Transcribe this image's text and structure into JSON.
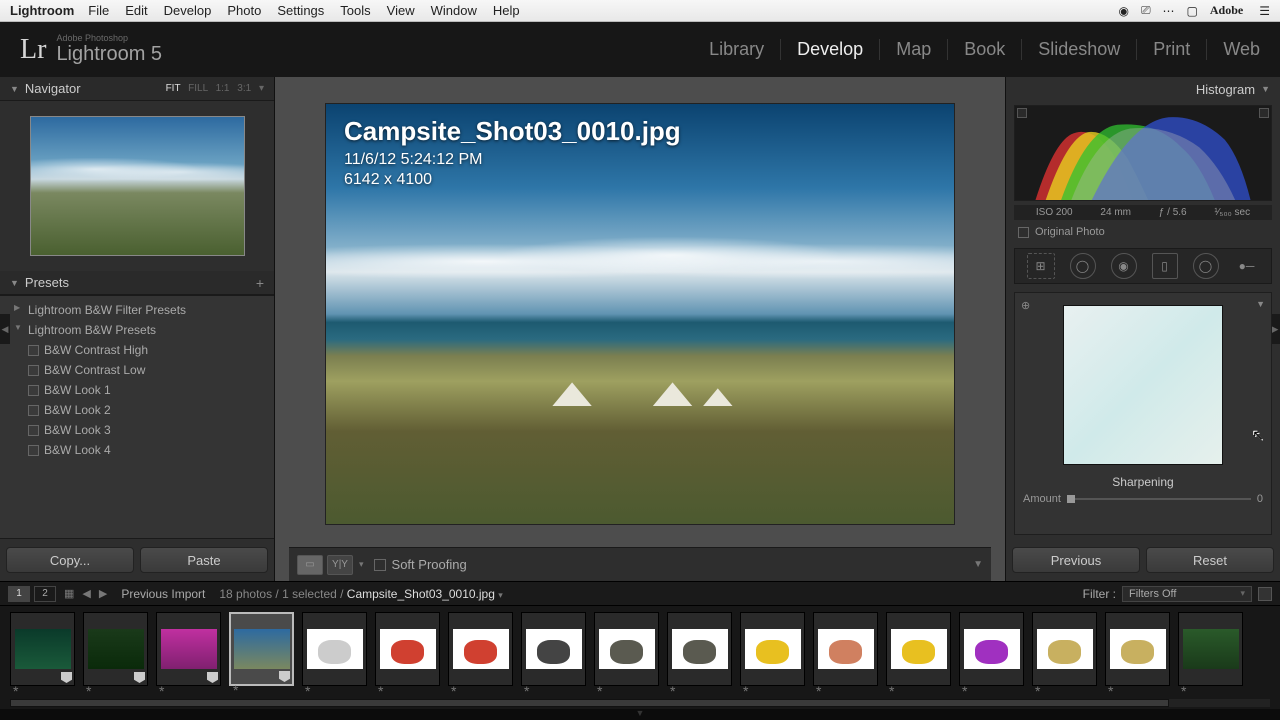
{
  "menubar": {
    "app": "Lightroom",
    "items": [
      "File",
      "Edit",
      "Develop",
      "Photo",
      "Settings",
      "Tools",
      "View",
      "Window",
      "Help"
    ],
    "right_brand": "Adobe"
  },
  "branding": {
    "logo": "Lr",
    "line1": "Adobe Photoshop",
    "line2": "Lightroom 5"
  },
  "modules": [
    "Library",
    "Develop",
    "Map",
    "Book",
    "Slideshow",
    "Print",
    "Web"
  ],
  "active_module": "Develop",
  "navigator": {
    "title": "Navigator",
    "zoom_modes": [
      "FIT",
      "FILL",
      "1:1",
      "3:1"
    ],
    "active_zoom": "FIT"
  },
  "presets": {
    "title": "Presets",
    "folders": [
      {
        "name": "Lightroom B&W Filter Presets",
        "open": false,
        "items": []
      },
      {
        "name": "Lightroom B&W Presets",
        "open": true,
        "items": [
          "B&W Contrast High",
          "B&W Contrast Low",
          "B&W Look 1",
          "B&W Look 2",
          "B&W Look 3",
          "B&W Look 4"
        ]
      }
    ]
  },
  "left_buttons": {
    "copy": "Copy...",
    "paste": "Paste"
  },
  "image": {
    "filename": "Campsite_Shot03_0010.jpg",
    "datetime": "11/6/12 5:24:12 PM",
    "dimensions": "6142 x 4100"
  },
  "center_toolbar": {
    "soft_proofing": "Soft Proofing"
  },
  "histogram": {
    "title": "Histogram",
    "iso": "ISO 200",
    "focal": "24 mm",
    "aperture": "ƒ / 5.6",
    "shutter": "¹⁄₅₀₀ sec",
    "original_photo": "Original Photo"
  },
  "detail": {
    "section": "Sharpening",
    "amount_label": "Amount",
    "amount_value": "0"
  },
  "right_buttons": {
    "previous": "Previous",
    "reset": "Reset"
  },
  "filmstrip_bar": {
    "primary": "1",
    "secondary": "2",
    "source": "Previous Import",
    "count": "18 photos / 1 selected / ",
    "filename": "Campsite_Shot03_0010.jpg",
    "filter_label": "Filter :",
    "filter_value": "Filters Off"
  },
  "thumbs_count": 17,
  "selected_thumb_index": 3
}
